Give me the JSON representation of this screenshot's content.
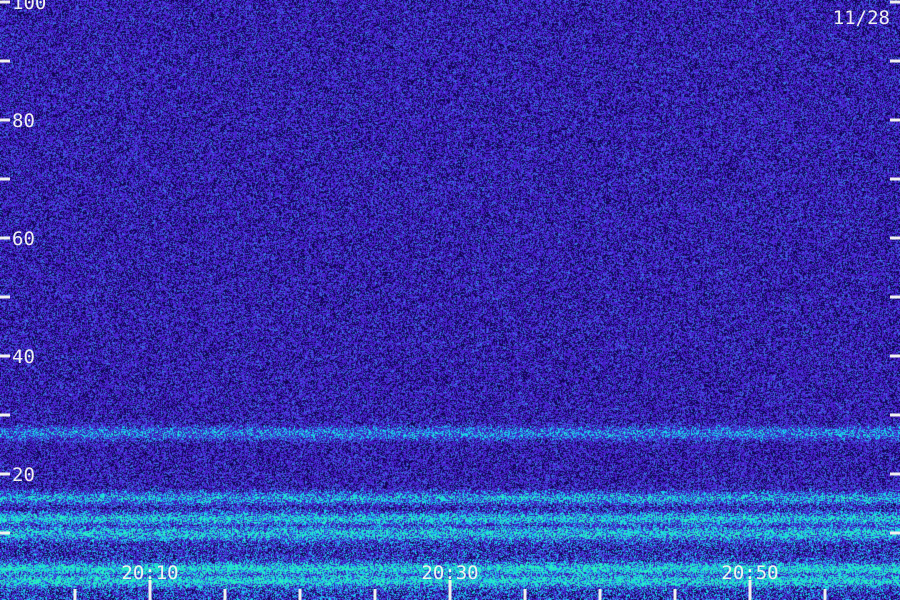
{
  "chart_data": {
    "type": "heatmap",
    "date_label": "11/28",
    "y_axis": {
      "ticks": [
        "20",
        "40",
        "60",
        "80",
        "100"
      ],
      "tick_values": [
        20,
        40,
        60,
        80,
        100
      ],
      "minor_values": [
        10,
        30,
        50,
        70,
        90
      ],
      "range": [
        0,
        102
      ]
    },
    "x_axis": {
      "ticks": [
        "20:10",
        "20:30",
        "20:50"
      ],
      "tick_minutes": [
        10,
        30,
        50
      ],
      "minor_minutes": [
        5,
        15,
        20,
        25,
        35,
        40,
        45,
        55
      ],
      "range_minutes": [
        0,
        60
      ]
    },
    "bands": [
      {
        "center": 27,
        "width": 1.2,
        "intensity": 0.55
      },
      {
        "center": 16,
        "width": 1.0,
        "intensity": 0.7
      },
      {
        "center": 12.5,
        "width": 1.0,
        "intensity": 0.85
      },
      {
        "center": 10,
        "width": 1.2,
        "intensity": 0.8
      },
      {
        "center": 4,
        "width": 1.0,
        "intensity": 0.95
      },
      {
        "center": 2,
        "width": 1.0,
        "intensity": 0.9
      }
    ],
    "colors": {
      "background": "#2a0f6e",
      "low": "#3a1fb0",
      "mid": "#1e90ff",
      "high": "#00ff88",
      "axis": "#f0f0f0"
    }
  }
}
